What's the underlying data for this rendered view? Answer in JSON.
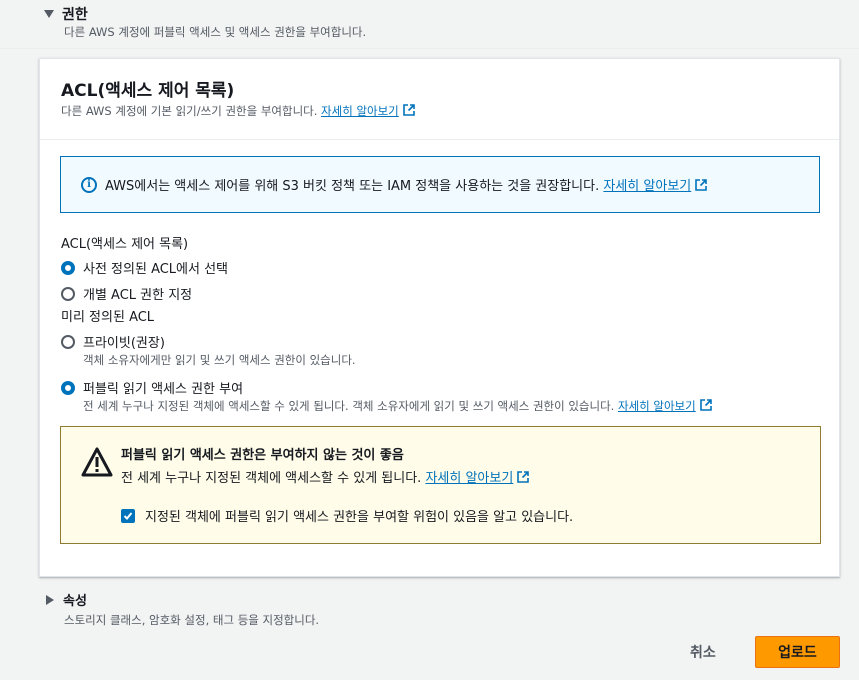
{
  "permissions": {
    "title": "권한",
    "description": "다른 AWS 계정에 퍼블릭 액세스 및 액세스 권한을 부여합니다."
  },
  "acl_panel": {
    "title": "ACL(액세스 제어 목록)",
    "description": "다른 AWS 계정에 기본 읽기/쓰기 권한을 부여합니다.",
    "learn_more": "자세히 알아보기"
  },
  "info_alert": {
    "text": "AWS에서는 액세스 제어를 위해 S3 버킷 정책 또는 IAM 정책을 사용하는 것을 권장합니다.",
    "link": "자세히 알아보기"
  },
  "acl_field": {
    "label": "ACL(액세스 제어 목록)",
    "options": [
      {
        "label": "사전 정의된 ACL에서 선택",
        "checked": true
      },
      {
        "label": "개별 ACL 권한 지정",
        "checked": false
      }
    ]
  },
  "predefined_field": {
    "label": "미리 정의된 ACL",
    "options": [
      {
        "label": "프라이빗(권장)",
        "description": "객체 소유자에게만 읽기 및 쓰기 액세스 권한이 있습니다.",
        "checked": false
      },
      {
        "label": "퍼블릭 읽기 액세스 권한 부여",
        "description": "전 세계 누구나 지정된 객체에 액세스할 수 있게 됩니다. 객체 소유자에게 읽기 및 쓰기 액세스 권한이 있습니다.",
        "link": "자세히 알아보기",
        "checked": true
      }
    ]
  },
  "warning": {
    "title": "퍼블릭 읽기 액세스 권한은 부여하지 않는 것이 좋음",
    "text": "전 세계 누구나 지정된 객체에 액세스할 수 있게 됩니다.",
    "link": "자세히 알아보기",
    "acknowledge": "지정된 객체에 퍼블릭 읽기 액세스 권한을 부여할 위험이 있음을 알고 있습니다.",
    "acknowledged": true
  },
  "properties": {
    "title": "속성",
    "description": "스토리지 클래스, 암호화 설정, 태그 등을 지정합니다."
  },
  "footer": {
    "cancel": "취소",
    "upload": "업로드"
  },
  "colors": {
    "accent": "#0073bb",
    "primary_button": "#ff9900",
    "warning_border": "#8f7b32",
    "warning_bg": "#fffce9",
    "info_bg": "#f1faff"
  }
}
